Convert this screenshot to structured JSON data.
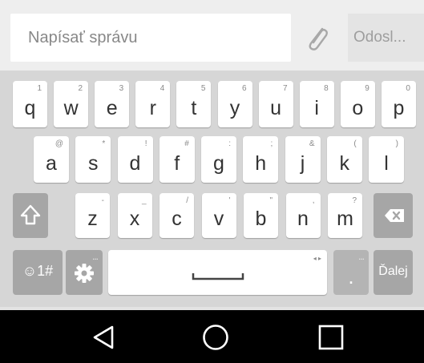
{
  "compose": {
    "placeholder": "Napísať správu",
    "send_label": "Odosl...",
    "attach_icon": "paperclip-icon"
  },
  "keyboard": {
    "row1": [
      {
        "k": "q",
        "h": "1"
      },
      {
        "k": "w",
        "h": "2"
      },
      {
        "k": "e",
        "h": "3"
      },
      {
        "k": "r",
        "h": "4"
      },
      {
        "k": "t",
        "h": "5"
      },
      {
        "k": "y",
        "h": "6"
      },
      {
        "k": "u",
        "h": "7"
      },
      {
        "k": "i",
        "h": "8"
      },
      {
        "k": "o",
        "h": "9"
      },
      {
        "k": "p",
        "h": "0"
      }
    ],
    "row2": [
      {
        "k": "a",
        "h": "@"
      },
      {
        "k": "s",
        "h": "*"
      },
      {
        "k": "d",
        "h": "!"
      },
      {
        "k": "f",
        "h": "#"
      },
      {
        "k": "g",
        "h": ":"
      },
      {
        "k": "h",
        "h": ";"
      },
      {
        "k": "j",
        "h": "&"
      },
      {
        "k": "k",
        "h": "("
      },
      {
        "k": "l",
        "h": ")"
      }
    ],
    "row3": [
      {
        "k": "z",
        "h": "-"
      },
      {
        "k": "x",
        "h": "_"
      },
      {
        "k": "c",
        "h": "/"
      },
      {
        "k": "v",
        "h": "'"
      },
      {
        "k": "b",
        "h": "\""
      },
      {
        "k": "n",
        "h": ","
      },
      {
        "k": "m",
        "h": "?"
      }
    ],
    "symbols_label": "☺1#",
    "settings_hint": "...",
    "space_hint": "◂ ▸",
    "period_label": ".",
    "period_hint": "...",
    "next_label": "Ďalej",
    "shift_icon": "shift-arrow-icon",
    "backspace_icon": "backspace-icon",
    "settings_icon": "gear-icon",
    "space_icon": "space-bar-icon"
  },
  "navbar": {
    "back_icon": "back-triangle-icon",
    "home_icon": "home-circle-icon",
    "recents_icon": "recents-square-icon"
  },
  "colors": {
    "keyboard_bg": "#d6d6d6",
    "key_bg": "#ffffff",
    "function_key_bg": "#a6a6a6",
    "navbar_bg": "#000000"
  }
}
